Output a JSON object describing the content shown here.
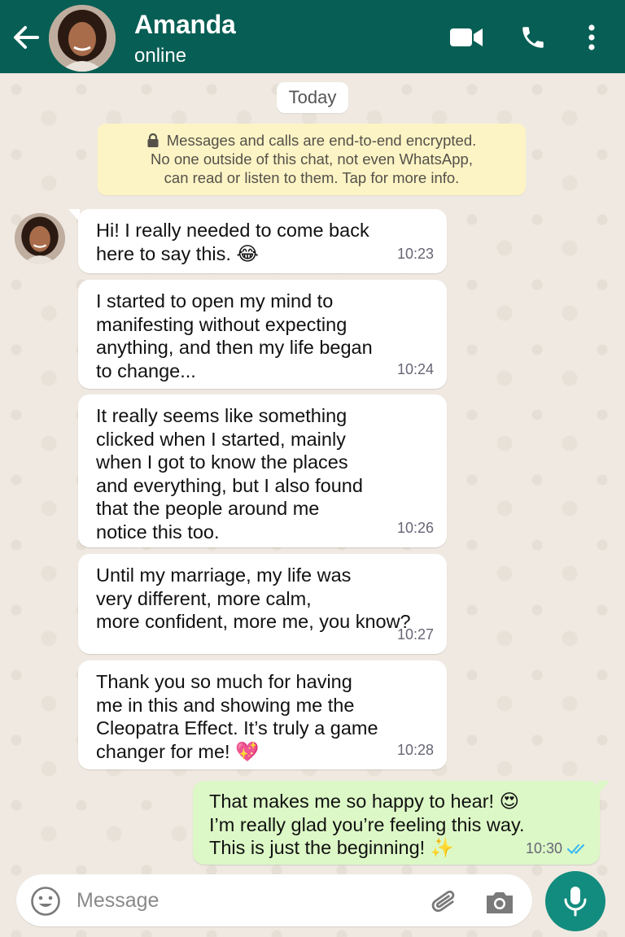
{
  "header": {
    "contact_name": "Amanda",
    "status": "online",
    "back_icon": "arrow-left-icon",
    "video_icon": "video-camera-icon",
    "call_icon": "phone-icon",
    "menu_icon": "more-vertical-icon",
    "bg_color": "#075e54"
  },
  "date_divider": "Today",
  "encryption_notice": {
    "line1": "Messages and calls are end-to-end encrypted.",
    "line2": "No one outside of this chat, not even WhatsApp,",
    "line3": "can read or listen to them. Tap for more info."
  },
  "messages": [
    {
      "direction": "in",
      "text": "Hi! I really needed to come back\nhere to say this. 😂",
      "time": "10:23"
    },
    {
      "direction": "in",
      "text": "I started to open my mind to\nmanifesting without expecting\nanything, and then my life began\nto change...",
      "time": "10:24"
    },
    {
      "direction": "in",
      "text": "It really seems like something\nclicked when I started, mainly\nwhen I got to know the places\nand everything, but I also found\nthat the people around me\nnotice this too.",
      "time": "10:26"
    },
    {
      "direction": "in",
      "text": "Until my marriage, my life was\nvery different, more calm,\nmore confident, more me, you know?",
      "time": "10:27"
    },
    {
      "direction": "in",
      "text": "Thank you so much for having\nme in this and showing me the\nCleopatra Effect. It’s truly a game\nchanger for me! 💖",
      "time": "10:28"
    },
    {
      "direction": "out",
      "text": "That makes me so happy to hear! 😍\nI’m really glad you’re feeling this way.\nThis is just the beginning! ✨",
      "time": "10:30",
      "status": "read"
    }
  ],
  "composer": {
    "placeholder": "Message",
    "emoji_icon": "emoji-icon",
    "attach_icon": "paperclip-icon",
    "camera_icon": "camera-icon",
    "mic_icon": "microphone-icon"
  },
  "colors": {
    "header": "#075e54",
    "outgoing_bubble": "#dcf8c6",
    "incoming_bubble": "#ffffff",
    "encryption_bg": "#fdf4c5",
    "mic_button": "#128c7e",
    "read_ticks": "#34b7f1"
  }
}
